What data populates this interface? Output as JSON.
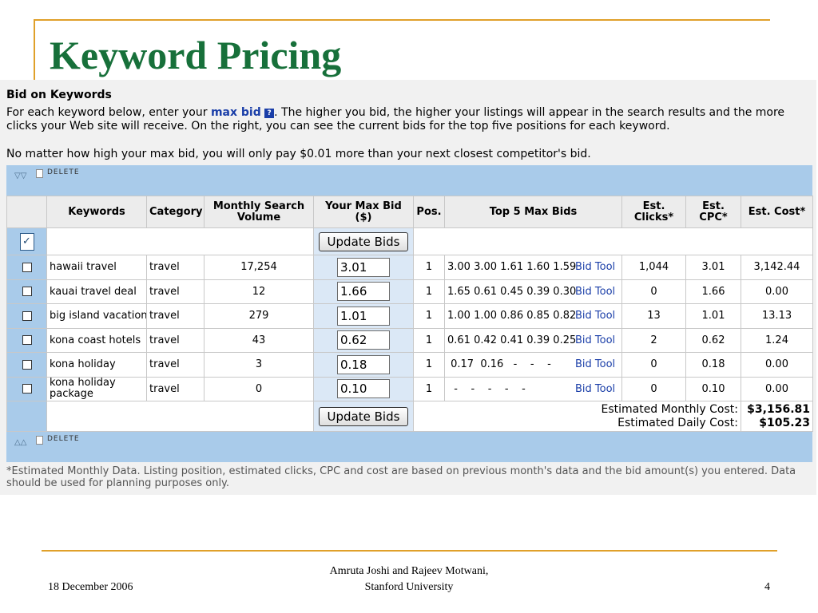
{
  "slide": {
    "title": "Keyword Pricing",
    "footer_date": "18 December 2006",
    "footer_authors_line1": "Amruta Joshi and Rajeev Motwani,",
    "footer_authors_line2": "Stanford University",
    "page_number": "4"
  },
  "panel": {
    "title": "Bid on Keywords",
    "intro_before": "For each keyword below, enter your ",
    "max_bid_link": "max bid",
    "help_glyph": "?",
    "intro_after": ".  The higher you bid, the higher your listings will appear in the search results and the more clicks your Web site will receive. On the right, you can see the current bids for the top five positions for each keyword.",
    "note": "No matter how high your max bid, you will only pay $0.01 more than your next closest competitor's bid.",
    "delete_label": "DELETE",
    "footnote": "*Estimated Monthly Data. Listing position, estimated clicks, CPC and cost are based on previous month's data and the bid amount(s) you entered. Data should be used for planning purposes only."
  },
  "table": {
    "headers": {
      "keywords": "Keywords",
      "category": "Category",
      "volume": "Monthly Search Volume",
      "max_bid": "Your Max Bid ($)",
      "pos": "Pos.",
      "top5": "Top 5 Max Bids",
      "clicks": "Est. Clicks*",
      "cpc": "Est. CPC*",
      "cost": "Est. Cost*"
    },
    "update_label": "Update Bids",
    "bid_tool_label": "Bid Tool",
    "rows": [
      {
        "keyword": "hawaii travel",
        "category": "travel",
        "volume": "17,254",
        "bid": "3.01",
        "pos": "1",
        "top5": "3.00 3.00 1.61 1.60 1.59",
        "clicks": "1,044",
        "cpc": "3.01",
        "cost": "3,142.44"
      },
      {
        "keyword": "kauai travel deal",
        "category": "travel",
        "volume": "12",
        "bid": "1.66",
        "pos": "1",
        "top5": "1.65 0.61 0.45 0.39 0.30",
        "clicks": "0",
        "cpc": "1.66",
        "cost": "0.00"
      },
      {
        "keyword": "big island vacation",
        "category": "travel",
        "volume": "279",
        "bid": "1.01",
        "pos": "1",
        "top5": "1.00 1.00 0.86 0.85 0.82",
        "clicks": "13",
        "cpc": "1.01",
        "cost": "13.13"
      },
      {
        "keyword": "kona coast hotels",
        "category": "travel",
        "volume": "43",
        "bid": "0.62",
        "pos": "1",
        "top5": "0.61 0.42 0.41 0.39 0.25",
        "clicks": "2",
        "cpc": "0.62",
        "cost": "1.24"
      },
      {
        "keyword": "kona holiday",
        "category": "travel",
        "volume": "3",
        "bid": "0.18",
        "pos": "1",
        "top5": " 0.17  0.16   -    -    -",
        "clicks": "0",
        "cpc": "0.18",
        "cost": "0.00"
      },
      {
        "keyword": "kona holiday package",
        "category": "travel",
        "volume": "0",
        "bid": "0.10",
        "pos": "1",
        "top5": "  -    -    -    -    -",
        "clicks": "0",
        "cpc": "0.10",
        "cost": "0.00"
      }
    ],
    "monthly_cost_label": "Estimated Monthly Cost:",
    "monthly_cost_value": "$3,156.81",
    "daily_cost_label": "Estimated Daily Cost:",
    "daily_cost_value": "$105.23"
  }
}
